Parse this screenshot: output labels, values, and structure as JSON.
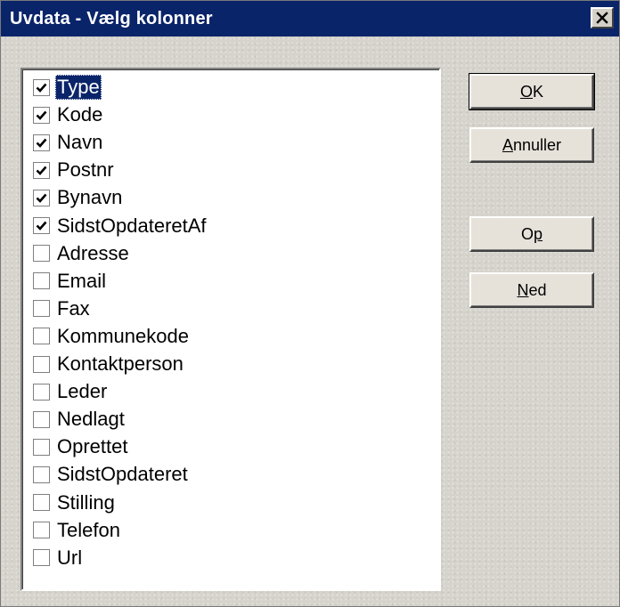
{
  "window": {
    "title": "Uvdata - Vælg kolonner",
    "close_glyph": "✕"
  },
  "columns": [
    {
      "label": "Type",
      "checked": true,
      "selected": true
    },
    {
      "label": "Kode",
      "checked": true,
      "selected": false
    },
    {
      "label": "Navn",
      "checked": true,
      "selected": false
    },
    {
      "label": "Postnr",
      "checked": true,
      "selected": false
    },
    {
      "label": "Bynavn",
      "checked": true,
      "selected": false
    },
    {
      "label": "SidstOpdateretAf",
      "checked": true,
      "selected": false
    },
    {
      "label": "Adresse",
      "checked": false,
      "selected": false
    },
    {
      "label": "Email",
      "checked": false,
      "selected": false
    },
    {
      "label": "Fax",
      "checked": false,
      "selected": false
    },
    {
      "label": "Kommunekode",
      "checked": false,
      "selected": false
    },
    {
      "label": "Kontaktperson",
      "checked": false,
      "selected": false
    },
    {
      "label": "Leder",
      "checked": false,
      "selected": false
    },
    {
      "label": "Nedlagt",
      "checked": false,
      "selected": false
    },
    {
      "label": "Oprettet",
      "checked": false,
      "selected": false
    },
    {
      "label": "SidstOpdateret",
      "checked": false,
      "selected": false
    },
    {
      "label": "Stilling",
      "checked": false,
      "selected": false
    },
    {
      "label": "Telefon",
      "checked": false,
      "selected": false
    },
    {
      "label": "Url",
      "checked": false,
      "selected": false
    }
  ],
  "buttons": {
    "ok": {
      "pre": "",
      "mnemonic": "O",
      "post": "K"
    },
    "cancel": {
      "pre": "",
      "mnemonic": "A",
      "post": "nnuller"
    },
    "up": {
      "pre": "O",
      "mnemonic": "p",
      "post": ""
    },
    "down": {
      "pre": "",
      "mnemonic": "N",
      "post": "ed"
    }
  },
  "colors": {
    "titlebar": "#0a246a",
    "selection": "#0a246a"
  }
}
